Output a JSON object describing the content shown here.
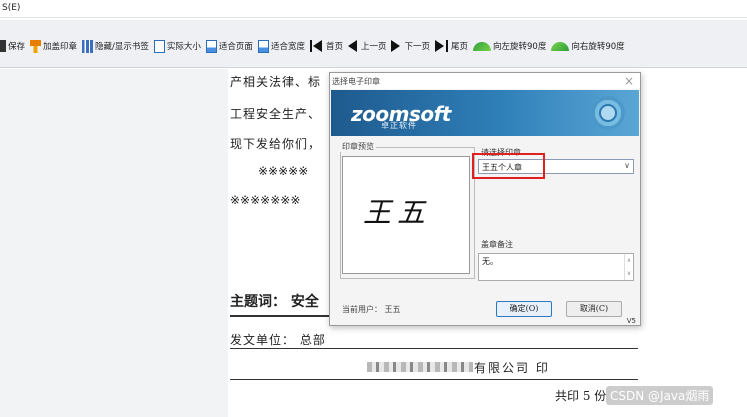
{
  "menubar": {
    "item": "S(E)"
  },
  "toolbar": {
    "save": "保存",
    "add_seal": "加盖印章",
    "toggle_bookmark": "隐藏/显示书签",
    "actual_size": "实际大小",
    "fit_page": "适合页面",
    "fit_width": "适合宽度",
    "first_page": "首页",
    "prev_page": "上一页",
    "next_page": "下一页",
    "last_page": "尾页",
    "rotate_left": "向左旋转90度",
    "rotate_right": "向右旋转90度"
  },
  "document": {
    "line1": "产相关法律、标",
    "line2": "工程安全生产、",
    "line3": "现下发给你们，",
    "line4": "※※※※※",
    "line5": "※※※※※※※",
    "subject": "主题词：  安全",
    "sender": "发文单位：  总部",
    "company": "有限公司  印",
    "pages": "共印 5 份",
    "watermark": "CSDN @Java烟雨"
  },
  "dialog": {
    "title": "选择电子印章",
    "brand": "zoomsoft",
    "brand_sub": "卓正软件",
    "preview_label": "印章预览",
    "signature_text": "王五",
    "select_label": "请选择印章",
    "selected_seal": "王五个人章",
    "remark_label": "盖章备注",
    "remark_value": "无。",
    "current_user": "当前用户：  王五",
    "ok_button": "确定(O)",
    "cancel_button": "取消(C)",
    "version": "V5"
  }
}
